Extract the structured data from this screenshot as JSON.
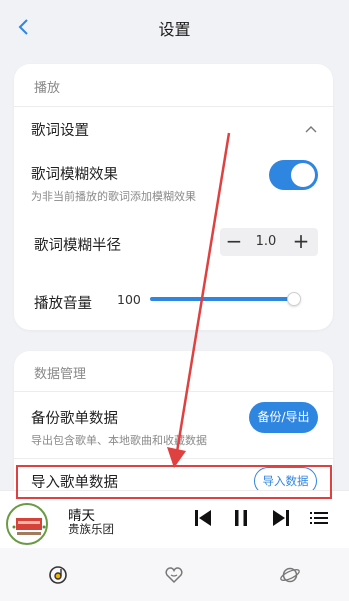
{
  "header": {
    "title": "设置",
    "back_icon": "chevron-left-icon"
  },
  "playback": {
    "section_title": "播放",
    "lyrics_settings_label": "歌词设置",
    "blur_label": "歌词模糊效果",
    "blur_desc": "为非当前播放的歌词添加模糊效果",
    "blur_enabled": true,
    "blur_radius_label": "歌词模糊半径",
    "blur_radius_value": "1.0",
    "minus": "−",
    "plus": "+",
    "volume_label": "播放音量",
    "volume_value": "100"
  },
  "data_mgmt": {
    "section_title": "数据管理",
    "backup_label": "备份歌单数据",
    "backup_desc": "导出包含歌单、本地歌曲和收藏数据",
    "backup_button": "备份/导出",
    "import_label": "导入歌单数据",
    "import_button": "导入数据"
  },
  "player": {
    "song_title": "晴天",
    "artist": "贵族乐团"
  },
  "tabs": [
    "music-disc-icon",
    "heart-icon",
    "planet-icon"
  ],
  "colors": {
    "accent": "#2f86e1",
    "highlight_red": "#e0403f"
  }
}
